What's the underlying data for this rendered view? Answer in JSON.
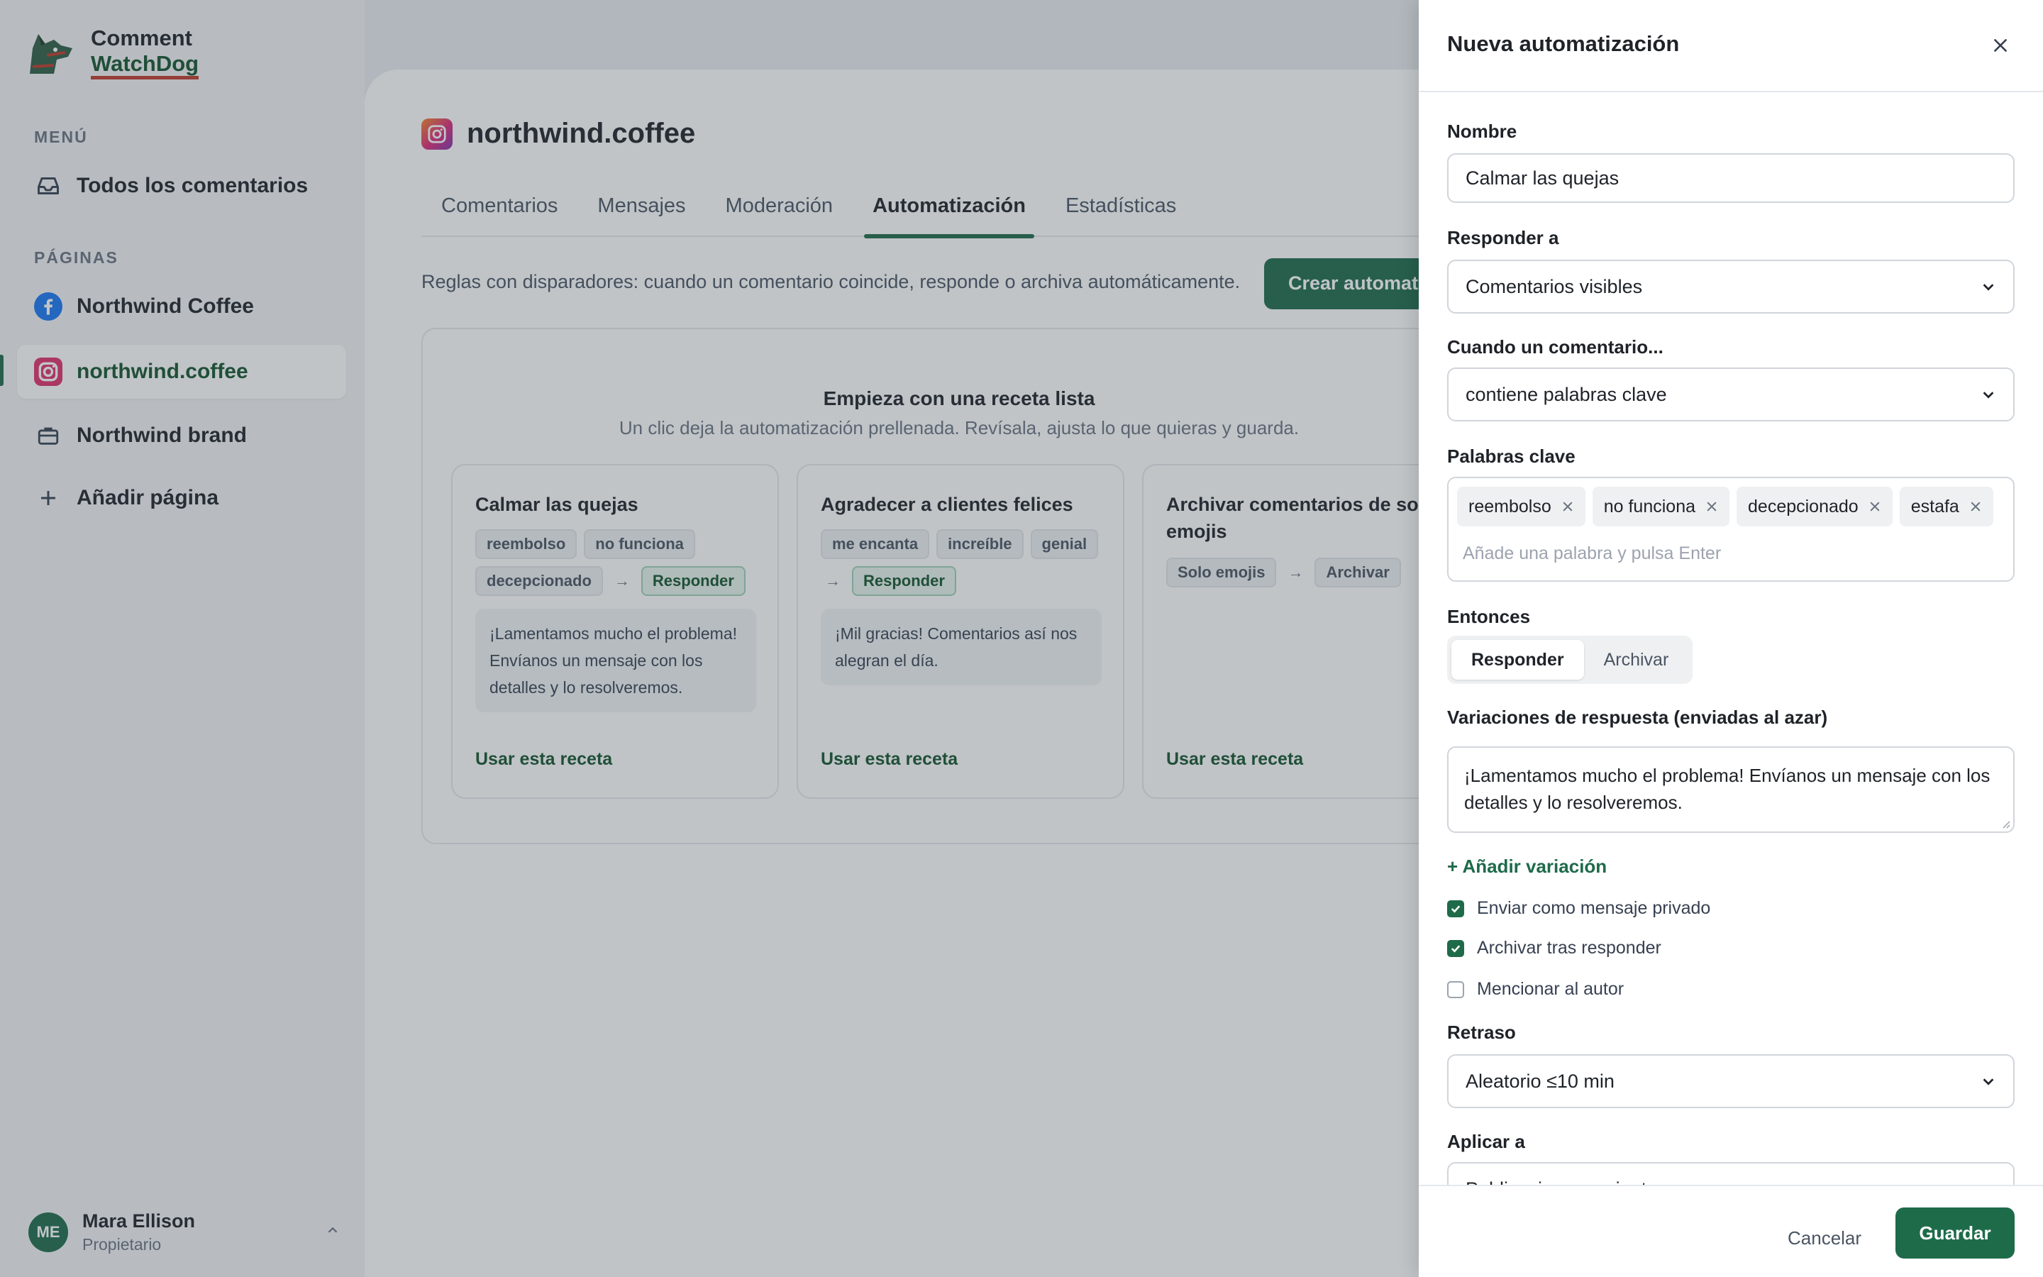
{
  "brand": {
    "name_line1": "Comment",
    "name_line2": "WatchDog"
  },
  "sidebar": {
    "menu_label": "MENÚ",
    "all_comments": "Todos los comentarios",
    "pages_label": "PÁGINAS",
    "pages": [
      {
        "label": "Northwind Coffee",
        "icon": "facebook-icon"
      },
      {
        "label": "northwind.coffee",
        "icon": "instagram-icon"
      },
      {
        "label": "Northwind brand",
        "icon": "briefcase-icon"
      }
    ],
    "add_page": "Añadir página",
    "user": {
      "initials": "ME",
      "name": "Mara Ellison",
      "role": "Propietario"
    }
  },
  "main": {
    "page_title": "northwind.coffee",
    "tabs": [
      "Comentarios",
      "Mensajes",
      "Moderación",
      "Automatización",
      "Estadísticas"
    ],
    "active_tab": "Automatización",
    "description": "Reglas con disparadores: cuando un comentario coincide, responde o archiva automáticamente.",
    "create_button": "Crear automatización",
    "recipes": {
      "title": "Empieza con una receta lista",
      "subtitle": "Un clic deja la automatización prellenada. Revísala, ajusta lo que quieras y guarda.",
      "use_label": "Usar esta receta",
      "items": [
        {
          "title": "Calmar las quejas",
          "chips": [
            "reembolso",
            "no funciona",
            "decepcionado"
          ],
          "action": "Responder",
          "message": "¡Lamentamos mucho el problema! Envíanos un mensaje con los detalles y lo resolveremos."
        },
        {
          "title": "Agradecer a clientes felices",
          "chips": [
            "me encanta",
            "increíble",
            "genial"
          ],
          "action": "Responder",
          "message": "¡Mil gracias! Comentarios así nos alegran el día."
        },
        {
          "title": "Archivar comentarios de solo emojis",
          "chips": [
            "Solo emojis"
          ],
          "action": "Archivar",
          "message": ""
        }
      ]
    }
  },
  "drawer": {
    "title": "Nueva automatización",
    "name_label": "Nombre",
    "name_value": "Calmar las quejas",
    "respond_to_label": "Responder a",
    "respond_to_value": "Comentarios visibles",
    "when_label": "Cuando un comentario...",
    "when_value": "contiene palabras clave",
    "keywords_label": "Palabras clave",
    "keywords": [
      "reembolso",
      "no funciona",
      "decepcionado",
      "estafa"
    ],
    "keywords_placeholder": "Añade una palabra y pulsa Enter",
    "then_label": "Entonces",
    "then_options": [
      "Responder",
      "Archivar"
    ],
    "then_selected": "Responder",
    "variations_label": "Variaciones de respuesta (enviadas al azar)",
    "variation_text": "¡Lamentamos mucho el problema! Envíanos un mensaje con los detalles y lo resolveremos.",
    "add_variation": "+ Añadir variación",
    "checkboxes": [
      {
        "label": "Enviar como mensaje privado",
        "checked": true
      },
      {
        "label": "Archivar tras responder",
        "checked": true
      },
      {
        "label": "Mencionar al autor",
        "checked": false
      }
    ],
    "delay_label": "Retraso",
    "delay_value": "Aleatorio ≤10 min",
    "apply_label": "Aplicar a",
    "apply_value": "Publicaciones recientes",
    "cancel": "Cancelar",
    "save": "Guardar"
  },
  "colors": {
    "accent": "#1e6b4a",
    "overlay": "#3c4650"
  }
}
